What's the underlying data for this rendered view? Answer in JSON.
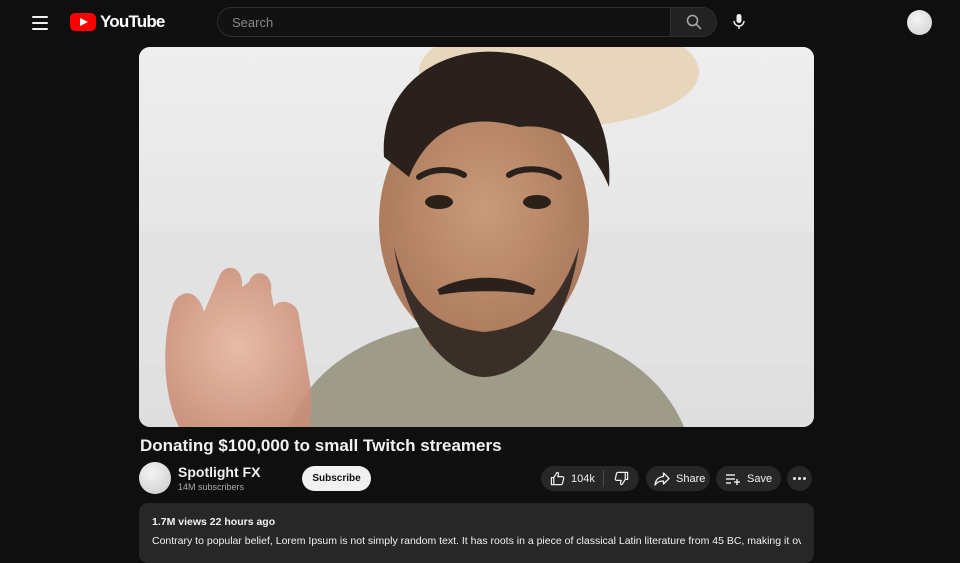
{
  "header": {
    "logo_text": "YouTube",
    "search_placeholder": "Search"
  },
  "video": {
    "title": "Donating $100,000 to small Twitch streamers",
    "channel_name": "Spotlight FX",
    "subscribers": "14M subscribers",
    "subscribe_label": "Subscribe",
    "like_count": "104k",
    "share_label": "Share",
    "save_label": "Save"
  },
  "description": {
    "meta": "1.7M views 22 hours ago",
    "text": "Contrary to popular belief, Lorem Ipsum is not simply random text. It has roots in a piece of classical Latin literature from 45 BC, making it over"
  },
  "colors": {
    "background": "#0f0f0f",
    "brand_red": "#ff0000",
    "pill_bg": "#272727",
    "subscribe_bg": "#f1f1f1"
  },
  "icons": [
    "menu-icon",
    "youtube-logo-icon",
    "search-icon",
    "microphone-icon",
    "thumbs-up-icon",
    "thumbs-down-icon",
    "share-icon",
    "save-playlist-icon",
    "more-icon"
  ]
}
